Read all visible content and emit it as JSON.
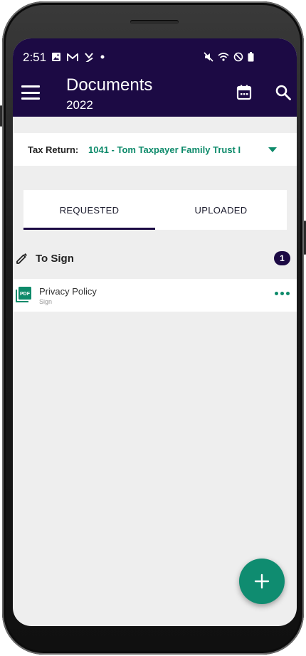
{
  "status_bar": {
    "time": "2:51",
    "left_icons": [
      "image-icon",
      "gmail-icon",
      "missed-call-icon",
      "dot-icon"
    ],
    "right_icons": [
      "mute-icon",
      "wifi-icon",
      "do-not-disturb-icon",
      "battery-icon"
    ]
  },
  "header": {
    "title": "Documents",
    "subtitle": "2022",
    "actions": [
      "menu-icon",
      "calendar-icon",
      "search-icon"
    ]
  },
  "tax_return": {
    "label": "Tax Return:",
    "value": "1041 - Tom Taxpayer Family Trust I"
  },
  "tabs": [
    {
      "label": "REQUESTED",
      "active": true
    },
    {
      "label": "UPLOADED",
      "active": false
    }
  ],
  "section": {
    "title": "To Sign",
    "count": "1",
    "items": [
      {
        "name": "Privacy Policy",
        "subtitle": "Sign",
        "icon": "pdf-icon"
      }
    ]
  },
  "fab": {
    "icon": "plus-icon"
  },
  "colors": {
    "header_bg": "#1c0a44",
    "accent_green": "#0d8a6a",
    "screen_bg": "#eeeeee"
  }
}
